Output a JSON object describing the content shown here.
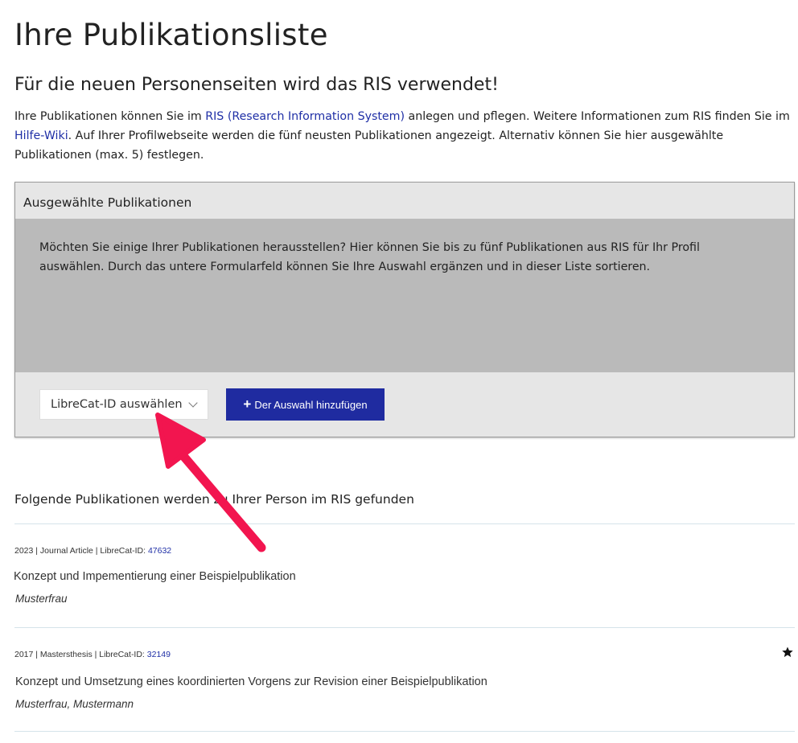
{
  "header": {
    "title": "Ihre Publikationsliste",
    "subtitle": "Für die neuen Personenseiten wird das RIS verwendet!"
  },
  "intro": {
    "text_1": "Ihre Publikationen können Sie im ",
    "ris_link": "RIS (Research Information System)",
    "text_2": " anlegen und pflegen. Weitere Informationen zum RIS finden Sie im ",
    "wiki_link": "Hilfe-Wiki",
    "text_3": ". Auf Ihrer Profilwebseite werden die fünf neusten Publikationen angezeigt. Alternativ können Sie hier ausgewählte Publikationen (max. 5) festlegen."
  },
  "panel": {
    "title": "Ausgewählte Publikationen",
    "body_text": "Möchten Sie einige Ihrer Publikationen herausstellen? Hier können Sie bis zu fünf Publikationen aus RIS für Ihr Profil auswählen. Durch das untere Formularfeld können Sie Ihre Auswahl ergänzen und in dieser Liste sortieren.",
    "select_label": "LibreCat-ID auswählen",
    "add_button_icon": "+",
    "add_button_label": "Der Auswahl hinzufügen"
  },
  "found": {
    "heading": "Folgende Publikationen werden zu Ihrer Person im RIS gefunden",
    "publications": [
      {
        "meta_prefix": "2023 | Journal Article | LibreCat-ID: ",
        "id": "47632",
        "title": "Konzept und Impementierung einer Beispielpublikation",
        "authors": "Musterfrau",
        "starred": false
      },
      {
        "meta_prefix": "2017 | Mastersthesis | LibreCat-ID: ",
        "id": "32149",
        "title": "Konzept und Umsetzung eines koordinierten Vorgens zur Revision einer Beispielpublikation",
        "authors": "Musterfrau, Mustermann",
        "starred": true,
        "star_icon": "star-icon"
      }
    ]
  },
  "colors": {
    "link": "#1f2fa6",
    "button": "#1f2ba0",
    "panel_header": "#e6e6e6",
    "panel_body": "#bababa",
    "divider": "#d5e3ea",
    "annotation_arrow": "#f2154f"
  }
}
